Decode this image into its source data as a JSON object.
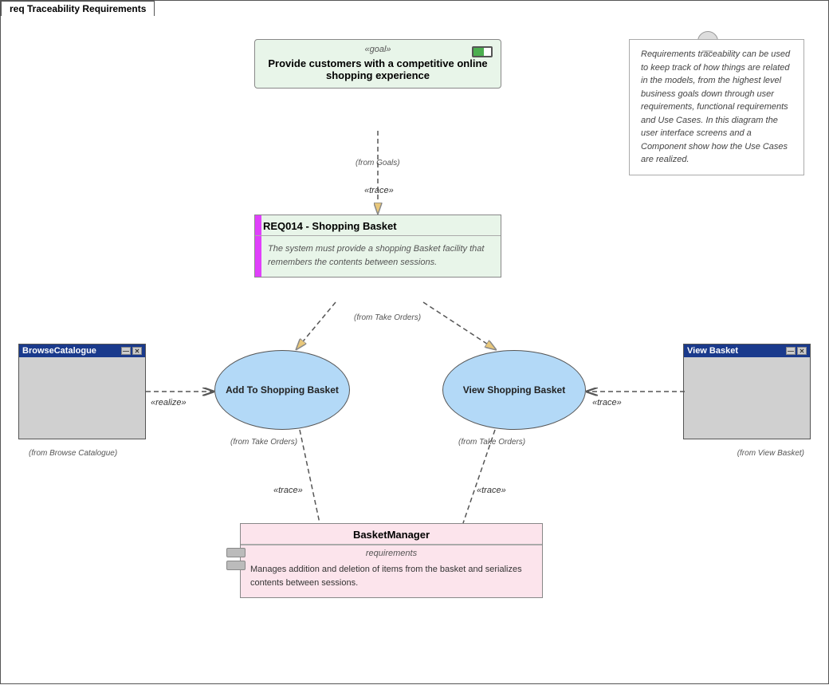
{
  "tab": "req Traceability Requirements",
  "goal": {
    "stereotype": "«goal»",
    "title": "Provide customers with a competitive online shopping experience",
    "from": "(from Goals)"
  },
  "note": {
    "text": "Requirements traceability can be used to keep track of how things are related in the models, from the highest level business goals down through user requirements, functional requirements and Use Cases.  In this diagram the user interface screens and a Component show how the Use Cases are realized."
  },
  "req": {
    "title": "REQ014 - Shopping Basket",
    "body": "The system must provide a shopping Basket facility that remembers the contents between sessions.",
    "from": "(from Take Orders)"
  },
  "trace_label_1": "«trace»",
  "trace_label_2": "«trace»",
  "trace_label_3": "«trace»",
  "realize_label": "«realize»",
  "usecase1": {
    "label": "Add To Shopping Basket",
    "from": "(from Take Orders)"
  },
  "usecase2": {
    "label": "View Shopping Basket",
    "from": "(from Take Orders)"
  },
  "browse_window": {
    "title": "BrowseCatalogue",
    "from": "(from Browse Catalogue)"
  },
  "viewbasket_window": {
    "title": "View Basket",
    "from": "(from View Basket)"
  },
  "basket_manager": {
    "title": "BasketManager",
    "section": "requirements",
    "body": "Manages addition and deletion of items from the basket and serializes contents between sessions."
  }
}
